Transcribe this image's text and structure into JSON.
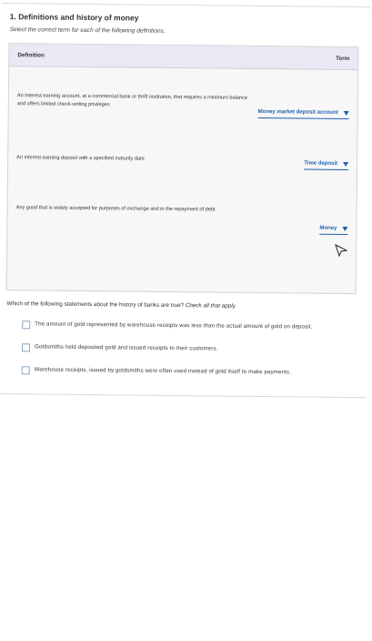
{
  "question1": {
    "title": "1. Definitions and history of money",
    "instruction": "Select the correct term for each of the following definitions."
  },
  "table": {
    "definition_header": "Definition",
    "term_header": "Term",
    "rows": [
      {
        "definition_line1": "An interest-earning account, at a commercial bank or thrift institution, that requires a minimum balance",
        "definition_line2": "and offers limited check-writing privileges",
        "term": "Money market deposit account"
      },
      {
        "definition_line1": "An interest-earning deposit with a specified maturity date",
        "term": "Time deposit"
      },
      {
        "definition_line1": "Any good that is widely accepted for purposes of exchange and in the repayment of debt",
        "term": "Money"
      }
    ]
  },
  "question2": {
    "prompt": "Which of the following statements about the history of banks are true?",
    "instruction": "Check all that apply.",
    "options": [
      {
        "label": "The amount of gold represented by warehouse receipts was less than the actual amount of gold on deposit.",
        "checked": false
      },
      {
        "label": "Goldsmiths held deposited gold and issued receipts to their customers.",
        "checked": false
      },
      {
        "label": "Warehouse receipts, issued by goldsmiths were often used instead of gold itself to make payments.",
        "checked": false
      }
    ]
  },
  "colors": {
    "accent": "#1f5fb0",
    "panel_background": "#f7f7f7",
    "header_background": "#e9e9f4"
  },
  "icons": {
    "cursor": "mouse-pointer-icon"
  }
}
